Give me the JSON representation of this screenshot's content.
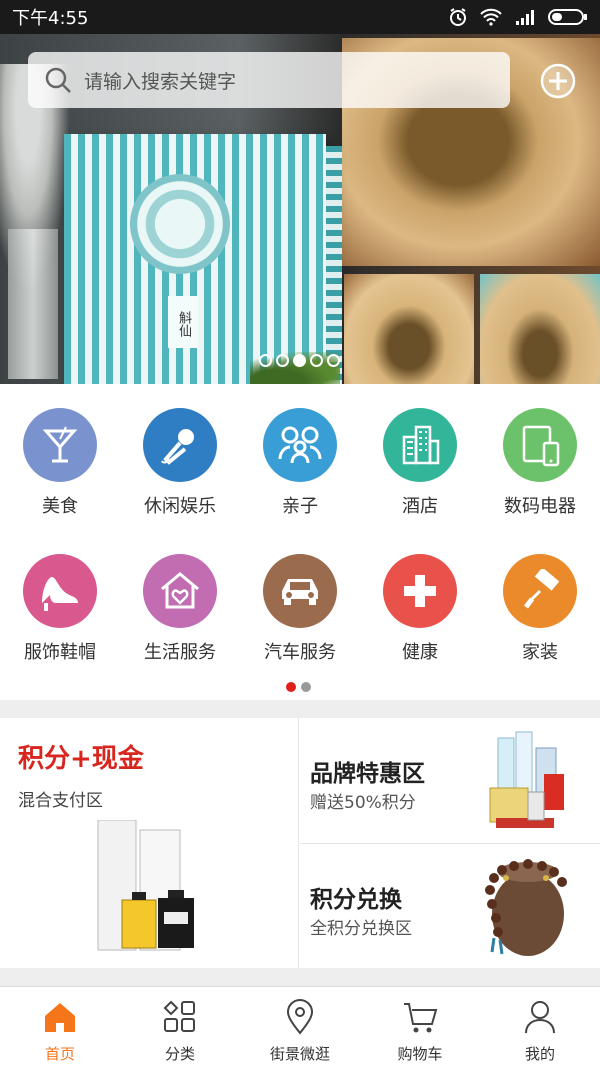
{
  "status_bar": {
    "time": "下午4:55"
  },
  "search": {
    "placeholder": "请输入搜索关键字"
  },
  "banner": {
    "product_mark": "斛仙",
    "page_count": 5,
    "active_page": 3
  },
  "categories": [
    {
      "label": "美食",
      "icon": "cocktail-icon",
      "color": "#7a93cf"
    },
    {
      "label": "休闲娱乐",
      "icon": "microphone-icon",
      "color": "#2f7ec4"
    },
    {
      "label": "亲子",
      "icon": "family-icon",
      "color": "#3a9ed6"
    },
    {
      "label": "酒店",
      "icon": "hotel-building-icon",
      "color": "#33b59a"
    },
    {
      "label": "数码电器",
      "icon": "devices-icon",
      "color": "#6cc26a"
    },
    {
      "label": "服饰鞋帽",
      "icon": "high-heel-icon",
      "color": "#d9588d"
    },
    {
      "label": "生活服务",
      "icon": "home-heart-icon",
      "color": "#c26cb1"
    },
    {
      "label": "汽车服务",
      "icon": "car-icon",
      "color": "#9a6b4d"
    },
    {
      "label": "健康",
      "icon": "medical-cross-icon",
      "color": "#e9524b"
    },
    {
      "label": "家装",
      "icon": "paint-roller-icon",
      "color": "#ea8a2b"
    }
  ],
  "category_pager": {
    "pages": 2,
    "active": 1
  },
  "promo": {
    "main_title": "积分+现金",
    "main_sub": "混合支付区",
    "cards": [
      {
        "title": "品牌特惠区",
        "sub": "赠送50%积分",
        "image": "drinks-product-image"
      },
      {
        "title": "积分兑换",
        "sub": "全积分兑换区",
        "image": "bead-bracelet-image"
      }
    ],
    "main_image": "perfume-product-image"
  },
  "nav": [
    {
      "label": "首页",
      "icon": "home-icon",
      "active": true
    },
    {
      "label": "分类",
      "icon": "category-grid-icon",
      "active": false
    },
    {
      "label": "街景微逛",
      "icon": "location-pin-icon",
      "active": false
    },
    {
      "label": "购物车",
      "icon": "shopping-cart-icon",
      "active": false
    },
    {
      "label": "我的",
      "icon": "user-icon",
      "active": false
    }
  ],
  "colors": {
    "accent": "#f5751a",
    "promo_red": "#d8251d",
    "pager_active": "#e0201a"
  }
}
